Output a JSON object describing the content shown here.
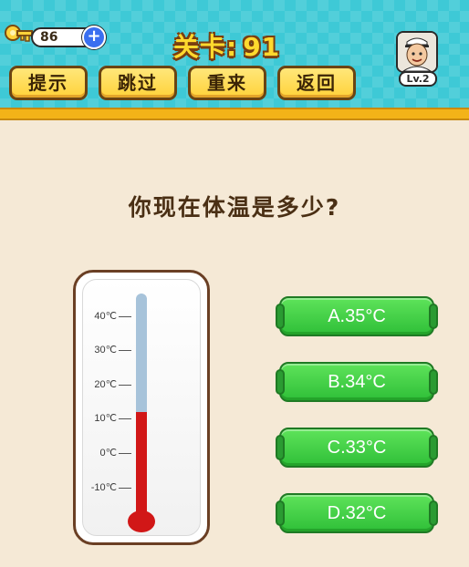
{
  "header": {
    "coins": "86",
    "level_label": "关卡:",
    "level_number": "91",
    "buttons": {
      "hint": "提示",
      "skip": "跳过",
      "restart": "重来",
      "back": "返回"
    },
    "player_level": "Lv.2"
  },
  "question": "你现在体温是多少?",
  "thermometer": {
    "ticks": [
      "40℃",
      "30℃",
      "20℃",
      "10℃",
      "0℃",
      "-10℃"
    ],
    "reading_celsius": 12
  },
  "answers": [
    "A.35°C",
    "B.34°C",
    "C.33°C",
    "D.32°C"
  ],
  "colors": {
    "header_bg": "#3ec9d6",
    "accent_yellow": "#ffd23a",
    "answer_green": "#2fbf38",
    "mercury_red": "#d11717",
    "background": "#f5e9d6"
  },
  "icons": [
    "key-icon",
    "plus-icon",
    "avatar-icon"
  ]
}
